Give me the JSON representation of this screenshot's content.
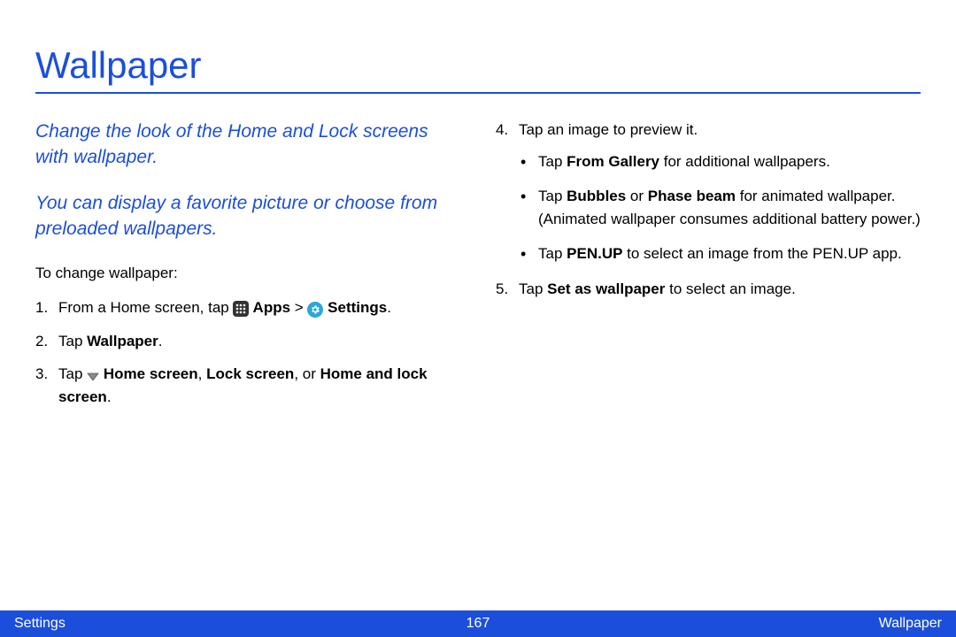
{
  "title": "Wallpaper",
  "intro1": "Change the look of the Home and Lock screens with wallpaper.",
  "intro2": "You can display a favorite picture or choose from preloaded wallpapers.",
  "lead": "To change wallpaper:",
  "step1_pre": "From a Home screen, tap ",
  "step1_apps": " Apps",
  "step1_gt": " > ",
  "step1_settings": " Settings",
  "step1_post": ".",
  "step2_pre": "Tap ",
  "step2_b": "Wallpaper",
  "step2_post": ".",
  "step3_pre": "Tap ",
  "step3_b1": " Home screen",
  "step3_mid1": ", ",
  "step3_b2": "Lock screen",
  "step3_mid2": ", or ",
  "step3_b3": "Home and lock screen",
  "step3_post": ".",
  "step4": "Tap an image to preview it.",
  "b4a_pre": "Tap ",
  "b4a_b": "From Gallery",
  "b4a_post": " for additional wallpapers.",
  "b4b_pre": "Tap ",
  "b4b_b1": "Bubbles",
  "b4b_mid": " or ",
  "b4b_b2": "Phase beam",
  "b4b_post": " for animated wallpaper. (Animated wallpaper consumes additional battery power.)",
  "b4c_pre": "Tap ",
  "b4c_b": "PEN.UP",
  "b4c_post": " to select an image from the PEN.UP app.",
  "step5_pre": "Tap ",
  "step5_b": "Set as wallpaper",
  "step5_post": " to select an image.",
  "footer": {
    "left": "Settings",
    "center": "167",
    "right": "Wallpaper"
  }
}
